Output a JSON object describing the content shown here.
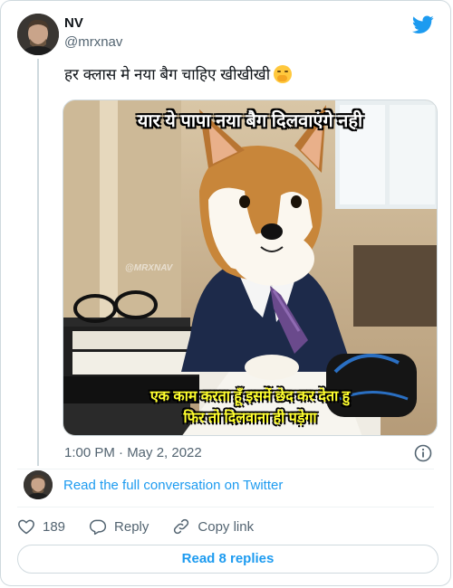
{
  "author": {
    "name": "NV",
    "handle": "@mrxnav"
  },
  "tweet": {
    "text": "हर क्लास मे नया बैग चाहिए खीखीखी",
    "emoji_icon": "face-with-hand-over-mouth-emoji"
  },
  "media": {
    "top_caption": "यार ये पापा नया बैग दिलवाएंगे नही",
    "bottom_caption_line1": "एक काम करता हूँ इसमें छेद कर देता हु",
    "bottom_caption_line2": "फिर तो दिलवाना ही पड़ेगा",
    "watermark": "@MRXNAV"
  },
  "timestamp": "1:00 PM · May 2, 2022",
  "conversation_link": "Read the full conversation on Twitter",
  "actions": {
    "like_count": "189",
    "reply_label": "Reply",
    "copy_link_label": "Copy link"
  },
  "read_replies_label": "Read 8 replies",
  "colors": {
    "twitter_blue": "#1d9bf0",
    "secondary_text": "#536471",
    "border": "#cfd9de"
  }
}
